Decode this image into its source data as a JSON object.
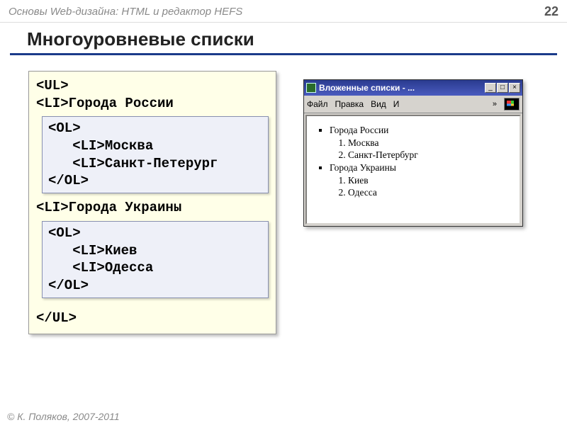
{
  "header": {
    "left": "Основы Web-дизайна: HTML и редактор HEFS",
    "page": "22"
  },
  "title": "Многоуровневые списки",
  "code": {
    "l1": "<UL>",
    "l2": "<LI>Города России",
    "ol1": {
      "a": "<OL>",
      "b": "   <LI>Москва",
      "c": "   <LI>Санкт-Петерург",
      "d": "</OL>"
    },
    "l3": "<LI>Города Украины",
    "ol2": {
      "a": "<OL>",
      "b": "   <LI>Киев",
      "c": "   <LI>Одесса",
      "d": "</OL>"
    },
    "l4": "</UL>"
  },
  "browser": {
    "title": "Вложенные списки - ...",
    "menu": {
      "file": "Файл",
      "edit": "Правка",
      "view": "Вид",
      "more": "И",
      "chev": "»"
    },
    "content": {
      "g1": "Города России",
      "g1a": "Москва",
      "g1b": "Санкт-Петербург",
      "g2": "Города Украины",
      "g2a": "Киев",
      "g2b": "Одесса"
    }
  },
  "footer": "© К. Поляков, 2007-2011"
}
